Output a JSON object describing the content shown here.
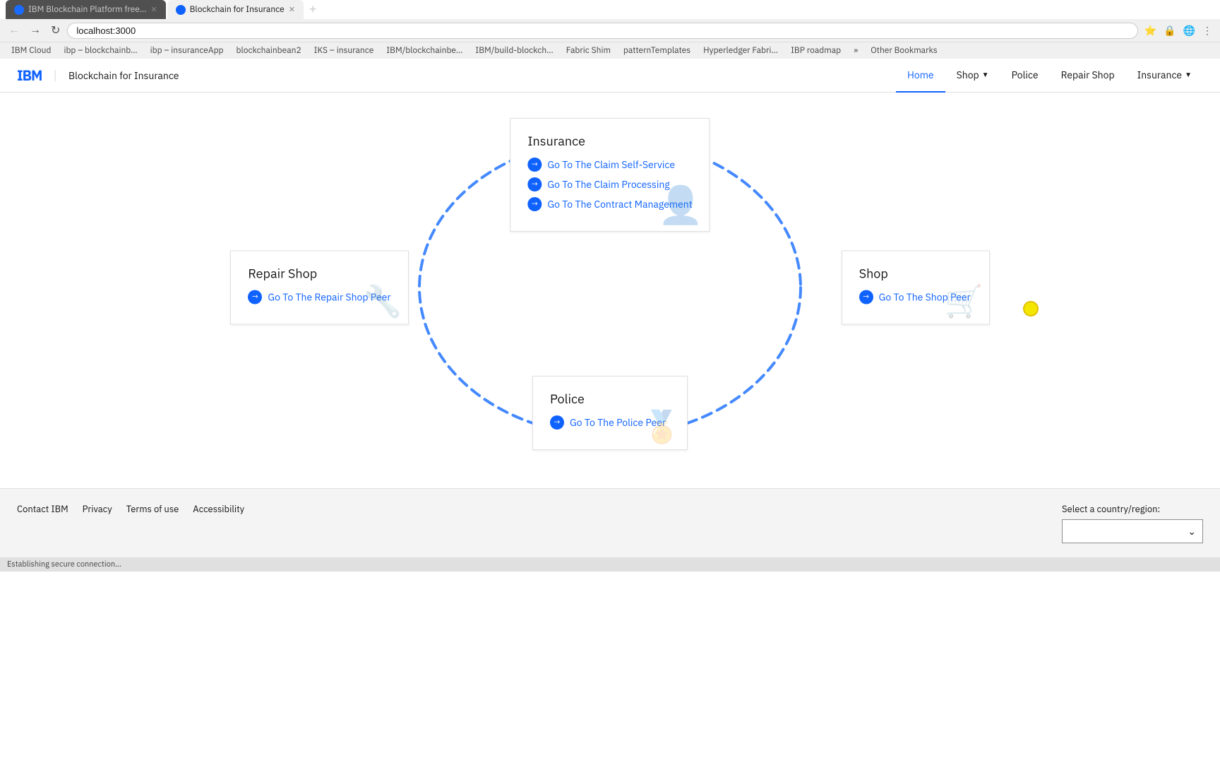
{
  "browser": {
    "tabs": [
      {
        "id": "tab1",
        "label": "IBM Blockchain Platform free...",
        "active": false,
        "favicon": "🔷"
      },
      {
        "id": "tab2",
        "label": "Blockchain for Insurance",
        "active": true,
        "favicon": "🔗"
      }
    ],
    "address": "localhost:3000",
    "bookmarks": [
      "IBM Cloud",
      "ibp – blockchainb…",
      "ibp – insuranceApp",
      "blockchainbean2",
      "IKS – insurance",
      "IBM/blockchainbe…",
      "IBM/build-blockch…",
      "Fabric Shim",
      "patternTemplates",
      "Hyperledger Fabri…",
      "IBP roadmap",
      "»",
      "Other Bookmarks"
    ]
  },
  "app": {
    "brand": "Blockchain for Insurance",
    "nav": {
      "items": [
        {
          "id": "home",
          "label": "Home",
          "active": true
        },
        {
          "id": "shop",
          "label": "Shop",
          "active": false,
          "hasDropdown": true
        },
        {
          "id": "police",
          "label": "Police",
          "active": false
        },
        {
          "id": "repair-shop",
          "label": "Repair Shop",
          "active": false
        },
        {
          "id": "insurance",
          "label": "Insurance",
          "active": false,
          "hasDropdown": true
        }
      ]
    }
  },
  "diagram": {
    "cards": {
      "insurance": {
        "title": "Insurance",
        "links": [
          {
            "id": "claim-self-service",
            "label": "Go To The Claim Self-Service"
          },
          {
            "id": "claim-processing",
            "label": "Go To The Claim Processing"
          },
          {
            "id": "contract-management",
            "label": "Go To The Contract Management"
          }
        ],
        "icon": "👤"
      },
      "repair_shop": {
        "title": "Repair Shop",
        "links": [
          {
            "id": "repair-shop-peer",
            "label": "Go To The Repair Shop Peer"
          }
        ],
        "icon": "🔧"
      },
      "shop": {
        "title": "Shop",
        "links": [
          {
            "id": "shop-peer",
            "label": "Go To The Shop Peer"
          }
        ],
        "icon": "🛒"
      },
      "police": {
        "title": "Police",
        "links": [
          {
            "id": "police-peer",
            "label": "Go To The Police Peer"
          }
        ],
        "icon": "🏅"
      }
    }
  },
  "footer": {
    "links": [
      {
        "id": "contact",
        "label": "Contact IBM"
      },
      {
        "id": "privacy",
        "label": "Privacy"
      },
      {
        "id": "terms",
        "label": "Terms of use"
      },
      {
        "id": "accessibility",
        "label": "Accessibility"
      }
    ],
    "country_label": "Select a country/region:"
  },
  "status_bar": {
    "text": "Establishing secure connection..."
  }
}
